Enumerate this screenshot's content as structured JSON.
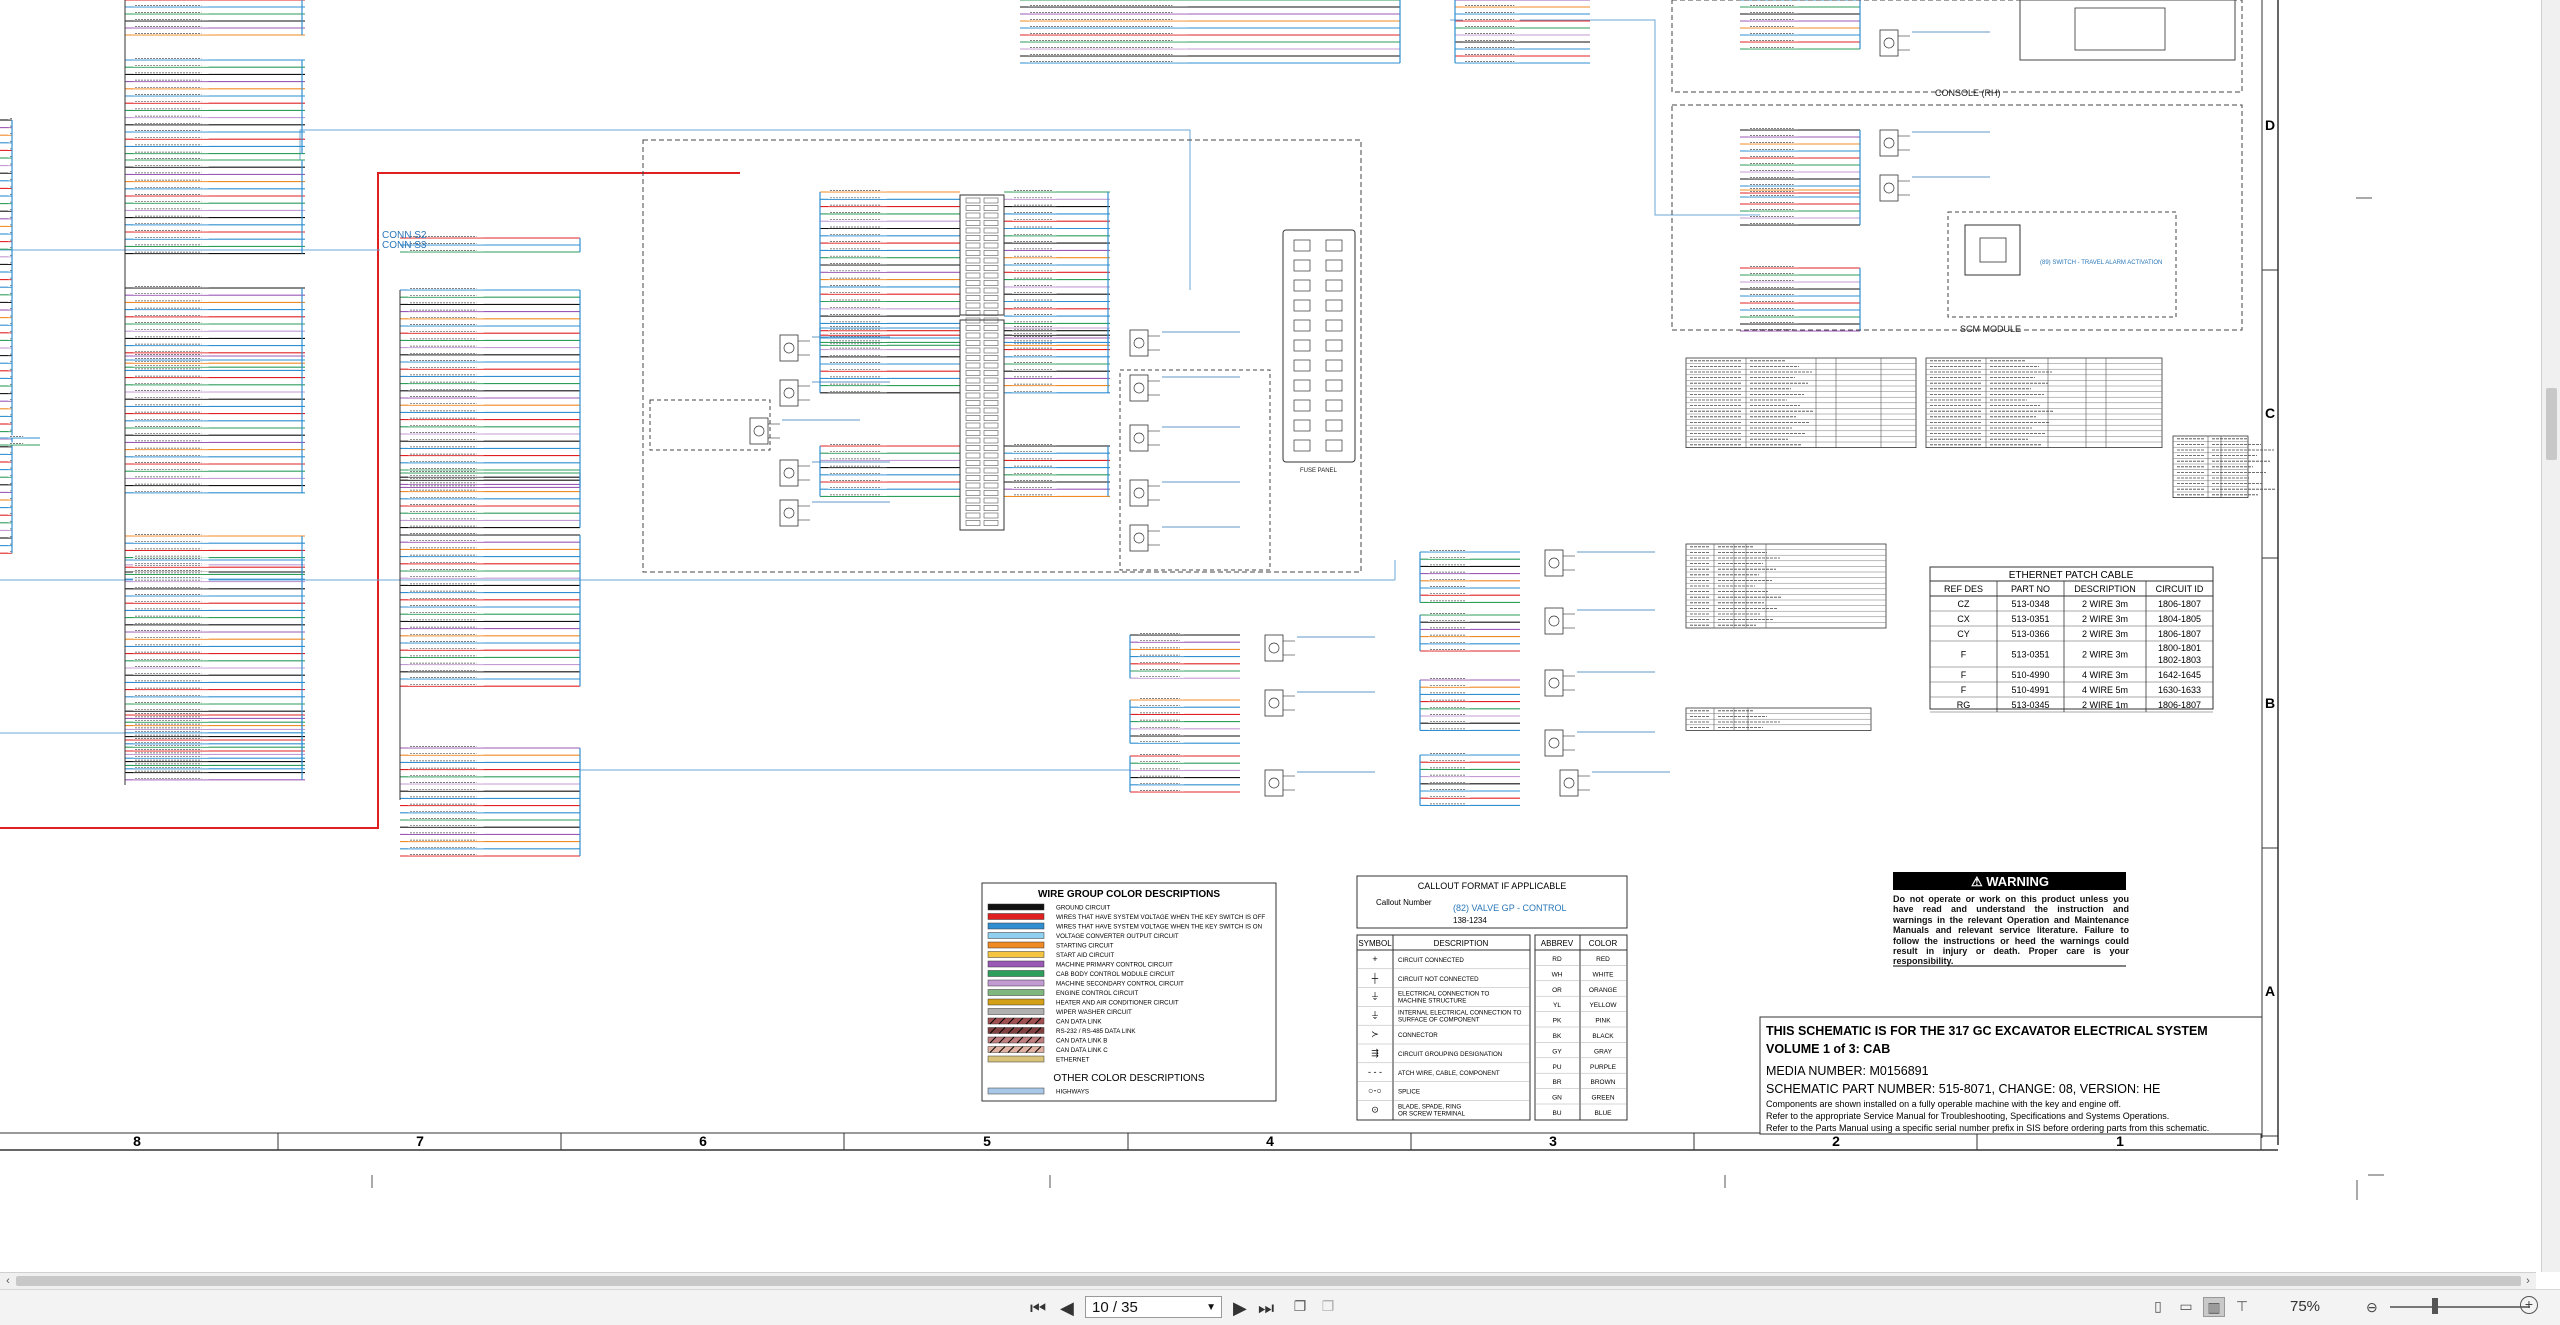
{
  "document": {
    "grid_columns": [
      "8",
      "7",
      "6",
      "5",
      "4",
      "3",
      "2",
      "1"
    ],
    "grid_rows": [
      "D",
      "C",
      "B",
      "A"
    ],
    "section_labels": {
      "console_rh": "CONSOLE (RH)",
      "scm_module": "SCM MODULE",
      "conn_s2": "CONN S2",
      "conn_s3": "CONN S3",
      "fuse_panel": "FUSE PANEL"
    },
    "ethernet_table": {
      "title": "ETHERNET PATCH CABLE",
      "headers": [
        "REF DES",
        "PART NO",
        "DESCRIPTION",
        "CIRCUIT ID"
      ],
      "rows": [
        [
          "CZ",
          "513-0348",
          "2 WIRE 3m",
          "1806-1807"
        ],
        [
          "CX",
          "513-0351",
          "2 WIRE 3m",
          "1804-1805"
        ],
        [
          "CY",
          "513-0366",
          "2 WIRE 3m",
          "1806-1807"
        ],
        [
          "F",
          "513-0351",
          "2 WIRE 3m",
          "1800-1801 / 1802-1803"
        ],
        [
          "F",
          "510-4990",
          "4 WIRE 3m",
          "1642-1645"
        ],
        [
          "F",
          "510-4991",
          "4 WIRE 5m",
          "1630-1633"
        ],
        [
          "RG",
          "513-0345",
          "2 WIRE 1m",
          "1806-1807"
        ]
      ]
    },
    "wire_group": {
      "title": "WIRE GROUP COLOR DESCRIPTIONS",
      "items": [
        {
          "color": "#111111",
          "label": "GROUND CIRCUIT"
        },
        {
          "color": "#e02020",
          "label": "WIRES THAT HAVE SYSTEM VOLTAGE WHEN THE KEY SWITCH IS OFF"
        },
        {
          "color": "#2f8fd0",
          "label": "WIRES THAT HAVE SYSTEM VOLTAGE WHEN THE KEY SWITCH IS ON"
        },
        {
          "color": "#8fd0f0",
          "label": "VOLTAGE CONVERTER OUTPUT CIRCUIT"
        },
        {
          "color": "#f08a24",
          "label": "STARTING CIRCUIT"
        },
        {
          "color": "#f5c542",
          "label": "START AID CIRCUIT"
        },
        {
          "color": "#9b59b6",
          "label": "MACHINE PRIMARY CONTROL CIRCUIT"
        },
        {
          "color": "#2e9e5b",
          "label": "CAB BODY CONTROL MODULE CIRCUIT"
        },
        {
          "color": "#c39bd3",
          "label": "MACHINE SECONDARY CONTROL CIRCUIT"
        },
        {
          "color": "#7fb77e",
          "label": "ENGINE CONTROL CIRCUIT"
        },
        {
          "color": "#d4a017",
          "label": "HEATER AND AIR CONDITIONER CIRCUIT"
        },
        {
          "color": "#b0b0b0",
          "label": "WIPER WASHER CIRCUIT"
        },
        {
          "color": "#a05050",
          "label": "CAN DATA LINK"
        },
        {
          "color": "#804040",
          "label": "RS-232 / RS-485 DATA LINK"
        },
        {
          "color": "#c08080",
          "label": "CAN DATA LINK B"
        },
        {
          "color": "#e0b0a0",
          "label": "CAN DATA LINK C"
        },
        {
          "color": "#d9c27a",
          "label": "ETHERNET"
        }
      ],
      "other_title": "OTHER COLOR DESCRIPTIONS",
      "other_items": [
        {
          "color": "#a9c7e6",
          "label": "HIGHWAYS"
        }
      ]
    },
    "callout": {
      "title": "CALLOUT FORMAT IF APPLICABLE",
      "callout_number": "Callout Number",
      "example": "(82) VALVE GP - CONTROL",
      "part_number": "138-1234",
      "symbol_headers": [
        "SYMBOL",
        "DESCRIPTION"
      ],
      "symbols": [
        "CIRCUIT CONNECTED",
        "CIRCUIT NOT CONNECTED",
        "ELECTRICAL CONNECTION TO MACHINE STRUCTURE",
        "INTERNAL ELECTRICAL CONNECTION TO SURFACE OF COMPONENT",
        "CONNECTOR",
        "CIRCUIT GROUPING DESIGNATION",
        "ATCH WIRE, CABLE, COMPONENT",
        "SPLICE",
        "BLADE, SPADE, RING OR SCREW TERMINAL"
      ],
      "abbrev_headers": [
        "ABBREV",
        "COLOR"
      ],
      "abbrevs": [
        [
          "RD",
          "RED"
        ],
        [
          "WH",
          "WHITE"
        ],
        [
          "OR",
          "ORANGE"
        ],
        [
          "YL",
          "YELLOW"
        ],
        [
          "PK",
          "PINK"
        ],
        [
          "BK",
          "BLACK"
        ],
        [
          "GY",
          "GRAY"
        ],
        [
          "PU",
          "PURPLE"
        ],
        [
          "BR",
          "BROWN"
        ],
        [
          "GN",
          "GREEN"
        ],
        [
          "BU",
          "BLUE"
        ]
      ]
    },
    "warning": {
      "title": "WARNING",
      "text": "Do not operate or work on this product unless you have read and understand the instruction and warnings in the relevant Operation and Maintenance Manuals and relevant service literature. Failure to follow the instructions or heed the warnings could result in injury or death. Proper care is your responsibility."
    },
    "titleblock": {
      "line1": "THIS SCHEMATIC IS FOR THE 317 GC EXCAVATOR ELECTRICAL SYSTEM",
      "line2": "VOLUME 1 of 3: CAB",
      "line3": "MEDIA NUMBER: M0156891",
      "line4": "SCHEMATIC PART NUMBER: 515-8071, CHANGE: 08, VERSION: HE",
      "line5": "Components are shown installed on a fully operable machine with the key and engine off.",
      "line6": "Refer to the appropriate Service Manual for Troubleshooting, Specifications and Systems Operations.",
      "line7": "Refer to the Parts Manual using a specific serial number prefix in SIS before ordering parts from this schematic."
    }
  },
  "viewer": {
    "page_display": "10 / 35",
    "zoom": "75%",
    "icons": {
      "first": "first-page-icon",
      "prev": "prev-page-icon",
      "next": "next-page-icon",
      "last": "last-page-icon"
    }
  }
}
